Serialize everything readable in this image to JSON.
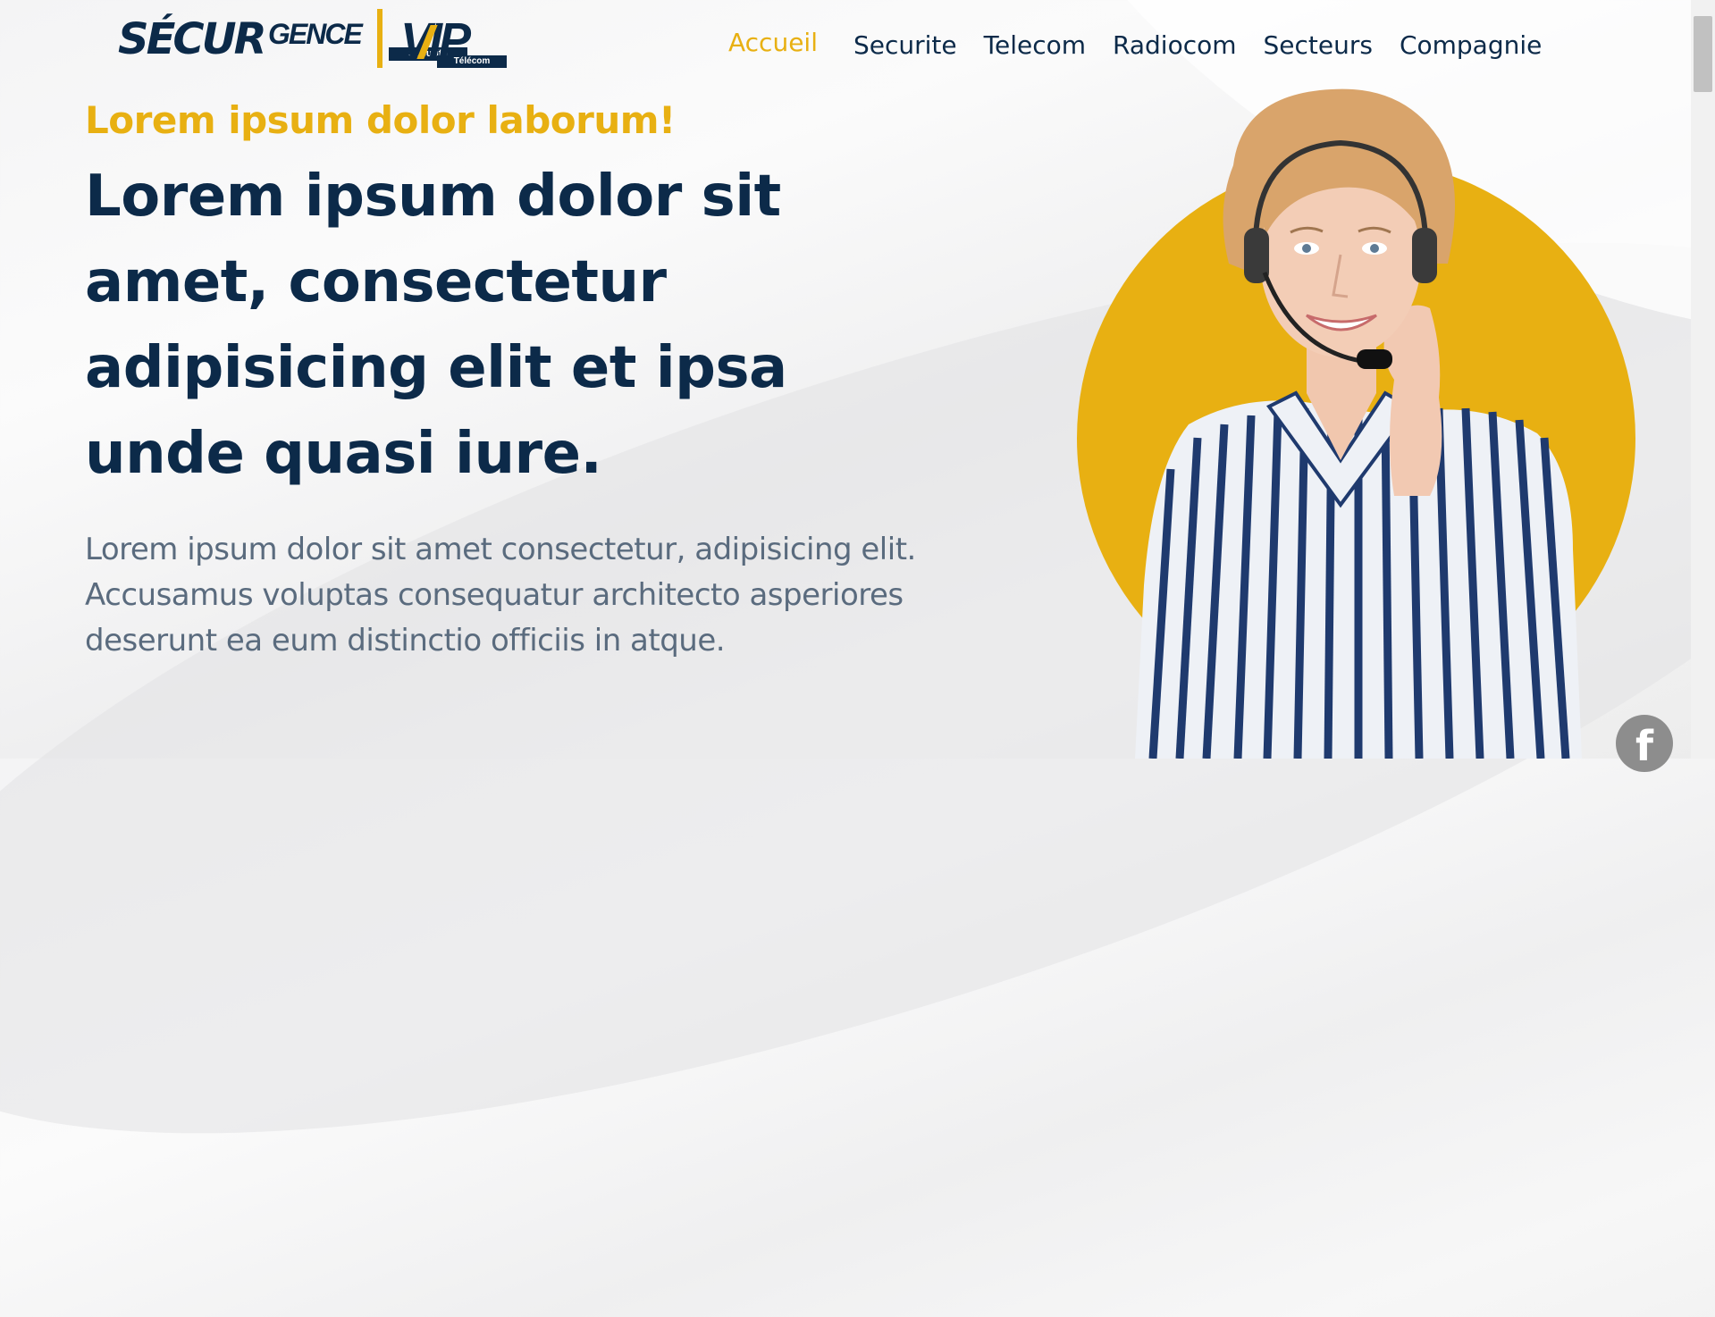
{
  "brand": {
    "logo_part1": "SÉCUR",
    "logo_part2": "GENCE",
    "logo_part2_sub": "Sécurité",
    "logo_part3": "VIP",
    "logo_part3_sub": "Télécom"
  },
  "nav": {
    "items": [
      {
        "label": "Accueil",
        "active": true
      },
      {
        "label": "Securite"
      },
      {
        "label": "Telecom"
      },
      {
        "label": "Radiocom"
      },
      {
        "label": "Secteurs"
      },
      {
        "label": "Compagnie"
      }
    ]
  },
  "hero": {
    "kicker": "Lorem ipsum dolor laborum!",
    "headline": "Lorem ipsum dolor sit amet, consectetur adipisicing elit et ipsa unde quasi iure.",
    "lede": "Lorem ipsum dolor sit amet consectetur, adipisicing elit. Accusamus voluptas consequatur architecto asperiores deserunt ea eum distinctio officiis in atque.",
    "image_subject": "call-center-agent-with-headset"
  },
  "social": {
    "facebook_glyph": "f",
    "facebook_icon": "facebook-icon"
  },
  "colors": {
    "navy": "#0c2a49",
    "gold": "#e8b012",
    "body_text": "#5a6b7e"
  }
}
